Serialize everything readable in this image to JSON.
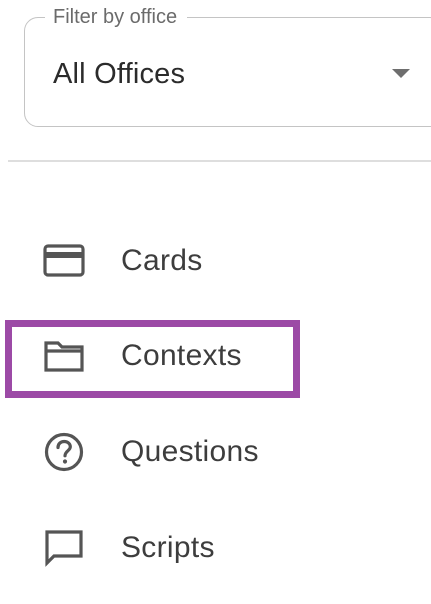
{
  "filter": {
    "label": "Filter by office",
    "value": "All Offices"
  },
  "nav": {
    "items": [
      {
        "label": "Cards",
        "icon": "card-icon"
      },
      {
        "label": "Contexts",
        "icon": "folder-icon"
      },
      {
        "label": "Questions",
        "icon": "help-circle-icon"
      },
      {
        "label": "Scripts",
        "icon": "chat-bubble-icon"
      }
    ]
  },
  "colors": {
    "highlight": "#9c4aa6",
    "icon": "#555555",
    "text": "#3d3d3d"
  }
}
